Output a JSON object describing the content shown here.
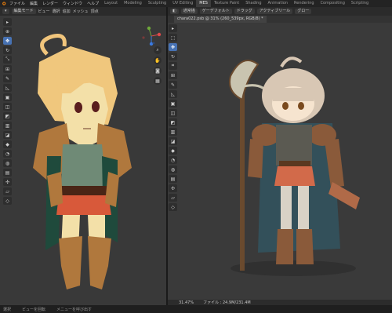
{
  "topbar": {
    "menus": [
      "ファイル",
      "編集",
      "レンダー",
      "ウィンドウ",
      "ヘルプ"
    ],
    "workspaces": [
      "Layout",
      "Modeling",
      "Sculpting",
      "UV Editing",
      "MES",
      "Texture Paint",
      "Shading",
      "Animation",
      "Rendering",
      "Compositing",
      "Scripting"
    ],
    "active_workspace": "MES"
  },
  "viewport": {
    "mode": "編集モード",
    "menus": [
      "ビュー",
      "選択",
      "追加",
      "メッシュ",
      "頂点"
    ]
  },
  "paint": {
    "options": [
      "通常描",
      "ゲーデフォルト",
      "ドラッグ",
      "アクティブリール",
      "グロー"
    ],
    "doc_tab": "chara022.psb @ 31% (260_539px, RGB/8) *",
    "zoom": "31.47%",
    "file_info": "ファイル : 24.9M/231.4M"
  },
  "statusbar": {
    "select": "選択",
    "rotate": "ビューを回転",
    "menu": "メニューを呼び出す"
  },
  "colors": {
    "viewport_bg": "#393939",
    "active_tool": "#4772b3",
    "canvas_bg": "#3a3a3a"
  }
}
